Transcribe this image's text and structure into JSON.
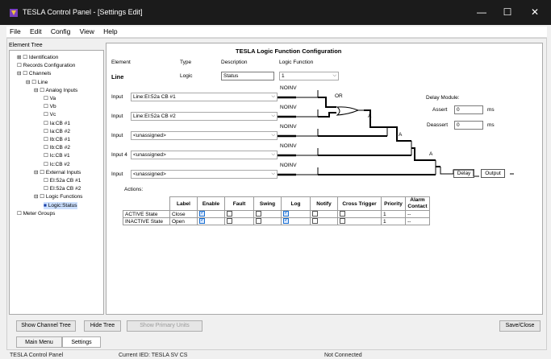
{
  "window": {
    "title": "TESLA Control Panel - [Settings Edit]",
    "minimize": "—",
    "maximize": "☐",
    "close": "✕"
  },
  "menu": {
    "items": [
      "File",
      "Edit",
      "Config",
      "View",
      "Help"
    ]
  },
  "tree": {
    "header": "Element Tree",
    "nodes": [
      {
        "label": "Identification",
        "prefix": "⊞ ☐"
      },
      {
        "label": "Records Configuration",
        "prefix": "☐"
      },
      {
        "label": "Channels",
        "prefix": "⊟ ☐"
      },
      {
        "label": "Line",
        "prefix": "⊟ ☐"
      },
      {
        "label": "Analog Inputs",
        "prefix": "⊟ ☐"
      },
      {
        "label": "Va",
        "prefix": "☐"
      },
      {
        "label": "Vb",
        "prefix": "☐"
      },
      {
        "label": "Vc",
        "prefix": "☐"
      },
      {
        "label": "Ia:CB #1",
        "prefix": "☐"
      },
      {
        "label": "Ia:CB #2",
        "prefix": "☐"
      },
      {
        "label": "Ib:CB #1",
        "prefix": "☐"
      },
      {
        "label": "Ib:CB #2",
        "prefix": "☐"
      },
      {
        "label": "Ic:CB #1",
        "prefix": "☐"
      },
      {
        "label": "Ic:CB #2",
        "prefix": "☐"
      },
      {
        "label": "External Inputs",
        "prefix": "⊟ ☐"
      },
      {
        "label": "EI:52a CB #1",
        "prefix": "☐"
      },
      {
        "label": "EI:52a CB #2",
        "prefix": "☐"
      },
      {
        "label": "Logic Functions",
        "prefix": "⊟ ☐"
      },
      {
        "label": "Logic:Status",
        "prefix": "■"
      },
      {
        "label": "Meter Groups",
        "prefix": "☐"
      }
    ]
  },
  "config": {
    "title": "TESLA Logic Function Configuration",
    "col_element": "Element",
    "col_type": "Type",
    "col_description": "Description",
    "col_logic_function": "Logic Function",
    "element": "Line",
    "type": "Logic",
    "description": "Status",
    "logic_function": "1",
    "inputs": [
      {
        "label": "Input",
        "value": "Line:EI:52a CB #1",
        "inv": "NOINV"
      },
      {
        "label": "Input",
        "value": "Line:EI:52a CB #2",
        "inv": "NOINV"
      },
      {
        "label": "Input",
        "value": "<unassigned>",
        "inv": "NOINV"
      },
      {
        "label": "Input 4",
        "value": "<unassigned>",
        "inv": "NOINV"
      },
      {
        "label": "Input",
        "value": "<unassigned>",
        "inv": "NOINV"
      }
    ],
    "gate_or": "OR",
    "gate_a1": "A",
    "gate_a2": "A",
    "gate_a3": "A",
    "delay_module": "Delay Module:",
    "assert_label": "Assert",
    "assert_value": "0",
    "assert_unit": "ms",
    "deassert_label": "Deassert",
    "deassert_value": "0",
    "deassert_unit": "ms",
    "delay_box": "Delay",
    "output_box": "Output"
  },
  "actions": {
    "label": "Actions:",
    "headers": [
      "Label",
      "Enable",
      "Fault",
      "Swing",
      "Log",
      "Notify",
      "Cross Trigger",
      "Priority",
      "Alarm Contact"
    ],
    "rows": [
      {
        "state": "ACTIVE State",
        "label": "Close",
        "enable": true,
        "fault": false,
        "swing": false,
        "log": true,
        "notify": false,
        "cross": false,
        "priority": "1",
        "alarm": "--"
      },
      {
        "state": "INACTIVE State",
        "label": "Open",
        "enable": true,
        "fault": false,
        "swing": false,
        "log": true,
        "notify": false,
        "cross": false,
        "priority": "1",
        "alarm": "--"
      }
    ]
  },
  "buttons": {
    "show_channel_tree": "Show Channel Tree",
    "hide_tree": "Hide Tree",
    "show_primary_units": "Show Primary Units",
    "save_close": "Save/Close"
  },
  "tabs": [
    "Main Menu",
    "Settings"
  ],
  "status": {
    "app": "TESLA Control Panel",
    "ied": "Current IED: TESLA SV CS",
    "connection": "Not Connected"
  }
}
